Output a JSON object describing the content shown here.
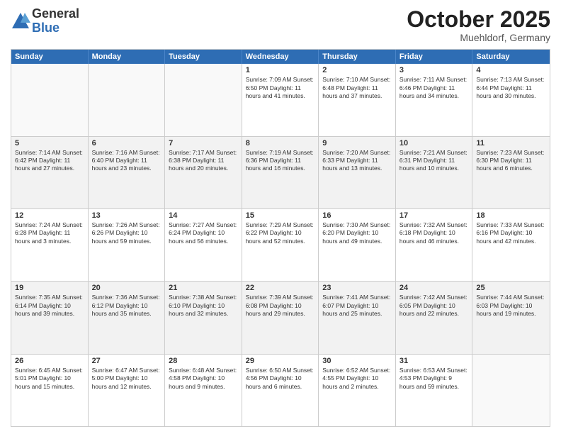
{
  "logo": {
    "general": "General",
    "blue": "Blue"
  },
  "title": "October 2025",
  "location": "Muehldorf, Germany",
  "days": [
    "Sunday",
    "Monday",
    "Tuesday",
    "Wednesday",
    "Thursday",
    "Friday",
    "Saturday"
  ],
  "weeks": [
    [
      {
        "day": "",
        "content": ""
      },
      {
        "day": "",
        "content": ""
      },
      {
        "day": "",
        "content": ""
      },
      {
        "day": "1",
        "content": "Sunrise: 7:09 AM\nSunset: 6:50 PM\nDaylight: 11 hours\nand 41 minutes."
      },
      {
        "day": "2",
        "content": "Sunrise: 7:10 AM\nSunset: 6:48 PM\nDaylight: 11 hours\nand 37 minutes."
      },
      {
        "day": "3",
        "content": "Sunrise: 7:11 AM\nSunset: 6:46 PM\nDaylight: 11 hours\nand 34 minutes."
      },
      {
        "day": "4",
        "content": "Sunrise: 7:13 AM\nSunset: 6:44 PM\nDaylight: 11 hours\nand 30 minutes."
      }
    ],
    [
      {
        "day": "5",
        "content": "Sunrise: 7:14 AM\nSunset: 6:42 PM\nDaylight: 11 hours\nand 27 minutes."
      },
      {
        "day": "6",
        "content": "Sunrise: 7:16 AM\nSunset: 6:40 PM\nDaylight: 11 hours\nand 23 minutes."
      },
      {
        "day": "7",
        "content": "Sunrise: 7:17 AM\nSunset: 6:38 PM\nDaylight: 11 hours\nand 20 minutes."
      },
      {
        "day": "8",
        "content": "Sunrise: 7:19 AM\nSunset: 6:36 PM\nDaylight: 11 hours\nand 16 minutes."
      },
      {
        "day": "9",
        "content": "Sunrise: 7:20 AM\nSunset: 6:33 PM\nDaylight: 11 hours\nand 13 minutes."
      },
      {
        "day": "10",
        "content": "Sunrise: 7:21 AM\nSunset: 6:31 PM\nDaylight: 11 hours\nand 10 minutes."
      },
      {
        "day": "11",
        "content": "Sunrise: 7:23 AM\nSunset: 6:30 PM\nDaylight: 11 hours\nand 6 minutes."
      }
    ],
    [
      {
        "day": "12",
        "content": "Sunrise: 7:24 AM\nSunset: 6:28 PM\nDaylight: 11 hours\nand 3 minutes."
      },
      {
        "day": "13",
        "content": "Sunrise: 7:26 AM\nSunset: 6:26 PM\nDaylight: 10 hours\nand 59 minutes."
      },
      {
        "day": "14",
        "content": "Sunrise: 7:27 AM\nSunset: 6:24 PM\nDaylight: 10 hours\nand 56 minutes."
      },
      {
        "day": "15",
        "content": "Sunrise: 7:29 AM\nSunset: 6:22 PM\nDaylight: 10 hours\nand 52 minutes."
      },
      {
        "day": "16",
        "content": "Sunrise: 7:30 AM\nSunset: 6:20 PM\nDaylight: 10 hours\nand 49 minutes."
      },
      {
        "day": "17",
        "content": "Sunrise: 7:32 AM\nSunset: 6:18 PM\nDaylight: 10 hours\nand 46 minutes."
      },
      {
        "day": "18",
        "content": "Sunrise: 7:33 AM\nSunset: 6:16 PM\nDaylight: 10 hours\nand 42 minutes."
      }
    ],
    [
      {
        "day": "19",
        "content": "Sunrise: 7:35 AM\nSunset: 6:14 PM\nDaylight: 10 hours\nand 39 minutes."
      },
      {
        "day": "20",
        "content": "Sunrise: 7:36 AM\nSunset: 6:12 PM\nDaylight: 10 hours\nand 35 minutes."
      },
      {
        "day": "21",
        "content": "Sunrise: 7:38 AM\nSunset: 6:10 PM\nDaylight: 10 hours\nand 32 minutes."
      },
      {
        "day": "22",
        "content": "Sunrise: 7:39 AM\nSunset: 6:08 PM\nDaylight: 10 hours\nand 29 minutes."
      },
      {
        "day": "23",
        "content": "Sunrise: 7:41 AM\nSunset: 6:07 PM\nDaylight: 10 hours\nand 25 minutes."
      },
      {
        "day": "24",
        "content": "Sunrise: 7:42 AM\nSunset: 6:05 PM\nDaylight: 10 hours\nand 22 minutes."
      },
      {
        "day": "25",
        "content": "Sunrise: 7:44 AM\nSunset: 6:03 PM\nDaylight: 10 hours\nand 19 minutes."
      }
    ],
    [
      {
        "day": "26",
        "content": "Sunrise: 6:45 AM\nSunset: 5:01 PM\nDaylight: 10 hours\nand 15 minutes."
      },
      {
        "day": "27",
        "content": "Sunrise: 6:47 AM\nSunset: 5:00 PM\nDaylight: 10 hours\nand 12 minutes."
      },
      {
        "day": "28",
        "content": "Sunrise: 6:48 AM\nSunset: 4:58 PM\nDaylight: 10 hours\nand 9 minutes."
      },
      {
        "day": "29",
        "content": "Sunrise: 6:50 AM\nSunset: 4:56 PM\nDaylight: 10 hours\nand 6 minutes."
      },
      {
        "day": "30",
        "content": "Sunrise: 6:52 AM\nSunset: 4:55 PM\nDaylight: 10 hours\nand 2 minutes."
      },
      {
        "day": "31",
        "content": "Sunrise: 6:53 AM\nSunset: 4:53 PM\nDaylight: 9 hours\nand 59 minutes."
      },
      {
        "day": "",
        "content": ""
      }
    ]
  ]
}
